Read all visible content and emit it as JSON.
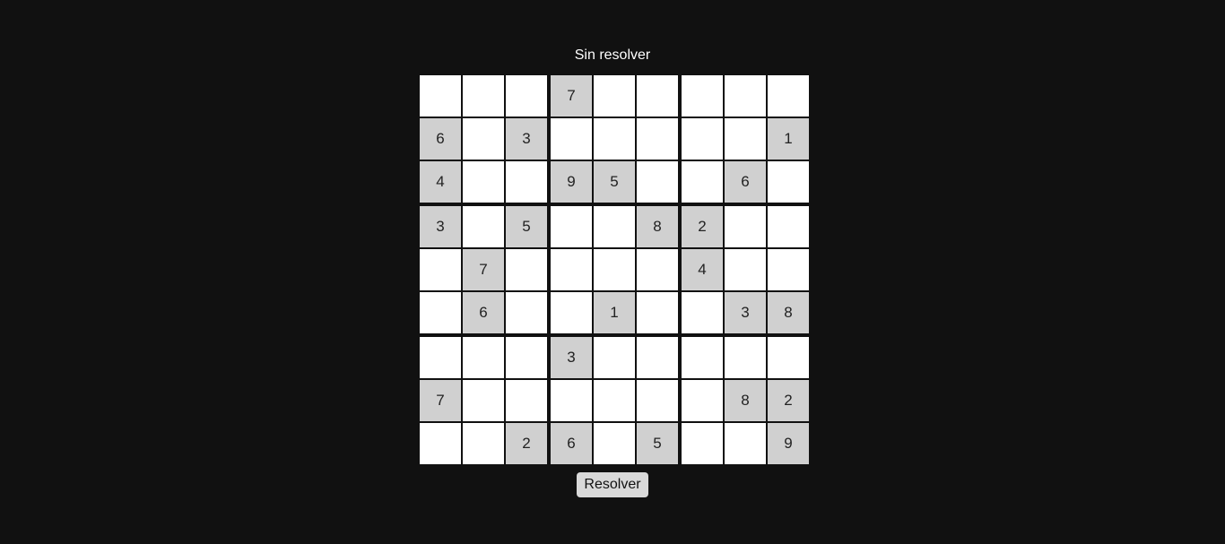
{
  "status": "Sin resolver",
  "solve_label": "Resolver",
  "colors": {
    "background": "#111111",
    "cell_empty": "#ffffff",
    "cell_given": "#d0d0d0",
    "grid_line": "#111111"
  },
  "board": [
    [
      "",
      "",
      "",
      "7",
      "",
      "",
      "",
      "",
      ""
    ],
    [
      "6",
      "",
      "3",
      "",
      "",
      "",
      "",
      "",
      "1"
    ],
    [
      "4",
      "",
      "",
      "9",
      "5",
      "",
      "",
      "6",
      ""
    ],
    [
      "3",
      "",
      "5",
      "",
      "",
      "8",
      "2",
      "",
      ""
    ],
    [
      "",
      "7",
      "",
      "",
      "",
      "",
      "4",
      "",
      ""
    ],
    [
      "",
      "6",
      "",
      "",
      "1",
      "",
      "",
      "3",
      "8"
    ],
    [
      "",
      "",
      "",
      "3",
      "",
      "",
      "",
      "",
      ""
    ],
    [
      "7",
      "",
      "",
      "",
      "",
      "",
      "",
      "8",
      "2"
    ],
    [
      "",
      "",
      "2",
      "6",
      "",
      "5",
      "",
      "",
      "9"
    ]
  ]
}
